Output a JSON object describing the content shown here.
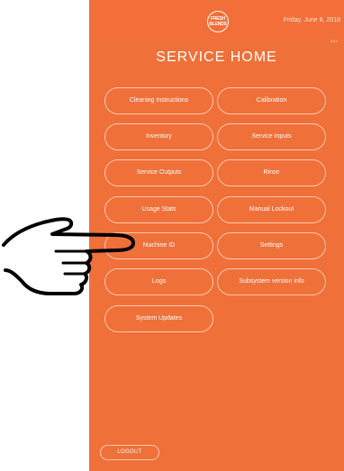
{
  "header": {
    "logo_text": "FRESH BLENDS",
    "date": "Friday, June 8, 2018",
    "corner_text": "XXX"
  },
  "title": "SERVICE HOME",
  "menu": {
    "items": [
      {
        "label": "Cleaning Instructions"
      },
      {
        "label": "Calibration"
      },
      {
        "label": "Inventory"
      },
      {
        "label": "Service Inputs"
      },
      {
        "label": "Service Outputs"
      },
      {
        "label": "Rinse"
      },
      {
        "label": "Usage Stats"
      },
      {
        "label": "Manual Lockout"
      },
      {
        "label": "Machine ID"
      },
      {
        "label": "Settings"
      },
      {
        "label": "Logs"
      },
      {
        "label": "Subsystem version info"
      },
      {
        "label": "System Updates"
      }
    ]
  },
  "footer": {
    "logout_label": "LOGOUT"
  },
  "colors": {
    "background": "#f0703a",
    "button_border": "#ffc7ad",
    "text": "#ffffff"
  }
}
